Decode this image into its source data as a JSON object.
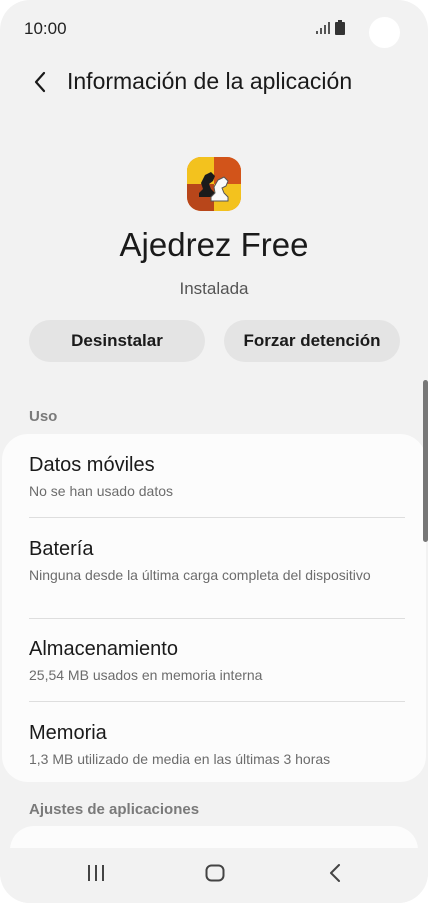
{
  "status_bar": {
    "time": "10:00"
  },
  "header": {
    "title": "Información de la aplicación"
  },
  "app": {
    "name": "Ajedrez Free",
    "status": "Instalada"
  },
  "buttons": {
    "uninstall": "Desinstalar",
    "force_stop": "Forzar detención"
  },
  "sections": {
    "usage": "Uso",
    "app_settings": "Ajustes de aplicaciones"
  },
  "usage_items": [
    {
      "title": "Datos móviles",
      "subtitle": "No se han usado datos"
    },
    {
      "title": "Batería",
      "subtitle": "Ninguna desde la última carga completa del dispositivo"
    },
    {
      "title": "Almacenamiento",
      "subtitle": "25,54 MB usados en memoria interna"
    },
    {
      "title": "Memoria",
      "subtitle": "1,3 MB utilizado de media en las últimas 3 horas"
    }
  ],
  "icons": {
    "back": "chevron-left-icon",
    "signal": "signal-icon",
    "battery": "battery-icon",
    "app": "chess-knight-icon",
    "nav_recents": "recents-icon",
    "nav_home": "home-icon",
    "nav_back": "back-icon"
  },
  "colors": {
    "background": "#f2f2f2",
    "card": "#fcfcfc",
    "button": "#e4e4e4",
    "app_icon_orange": "#e8741c",
    "app_icon_dark": "#b8461a"
  }
}
